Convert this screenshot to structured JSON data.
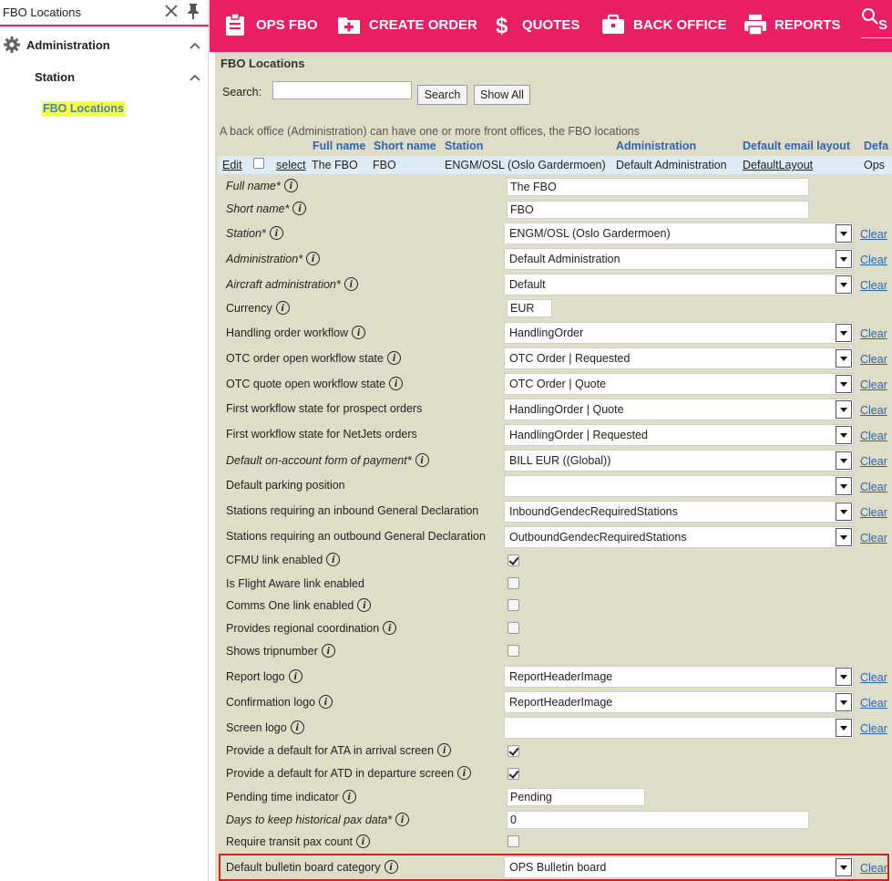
{
  "sidebar": {
    "search_value": "FBO Locations",
    "administration_label": "Administration",
    "station_label": "Station",
    "fbo_locations_label": "FBO Locations"
  },
  "nav": {
    "ops_fbo": "OPS FBO",
    "create_order": "CREATE ORDER",
    "quotes": "QUOTES",
    "back_office": "BACK OFFICE",
    "reports": "REPORTS",
    "search_partial": "S"
  },
  "colors": {
    "accent": "#e91e63",
    "panel_bg": "#deddc8",
    "link": "#2b64b4",
    "highlight": "#ffff33"
  },
  "panel": {
    "title": "FBO Locations",
    "search_label": "Search:",
    "search_value": "",
    "search_button": "Search",
    "show_all_button": "Show All",
    "description": "A back office (Administration) can have one or more front offices, the FBO locations"
  },
  "columns": [
    "Full name",
    "Short name",
    "Station",
    "Administration",
    "Default email layout",
    "Defa"
  ],
  "list_row": {
    "edit": "Edit",
    "select": "select",
    "full_name": "The FBO",
    "short_name": "FBO",
    "station": "ENGM/OSL (Oslo Gardermoen)",
    "administration": "Default Administration",
    "email_layout": "DefaultLayout",
    "default": "Ops"
  },
  "clear_label": "Clear",
  "fields": {
    "full_name": {
      "label": "Full name*",
      "value": "The FBO"
    },
    "short_name": {
      "label": "Short name*",
      "value": "FBO"
    },
    "station": {
      "label": "Station*",
      "value": "ENGM/OSL (Oslo Gardermoen)"
    },
    "administration": {
      "label": "Administration*",
      "value": "Default Administration"
    },
    "aircraft_administration": {
      "label": "Aircraft administration*",
      "value": "Default"
    },
    "currency": {
      "label": "Currency",
      "value": "EUR"
    },
    "handling_order_workflow": {
      "label": "Handling order workflow",
      "value": "HandlingOrder"
    },
    "otc_order_open": {
      "label": "OTC order open workflow state",
      "value": "OTC Order | Requested"
    },
    "otc_quote_open": {
      "label": "OTC quote open workflow state",
      "value": "OTC Order | Quote"
    },
    "first_state_prospect": {
      "label": "First workflow state for prospect orders",
      "value": "HandlingOrder | Quote"
    },
    "first_state_netjets": {
      "label": "First workflow state for NetJets orders",
      "value": "HandlingOrder | Requested"
    },
    "default_payment": {
      "label": "Default on-account form of payment*",
      "value": "BILL EUR ((Global))"
    },
    "parking_position": {
      "label": "Default parking position",
      "value": ""
    },
    "inbound_gendec": {
      "label": "Stations requiring an inbound General Declaration",
      "value": "InboundGendecRequiredStations"
    },
    "outbound_gendec": {
      "label": "Stations requiring an outbound General Declaration",
      "value": "OutboundGendecRequiredStations"
    },
    "cfmu_link": {
      "label": "CFMU link enabled",
      "checked": true
    },
    "flight_aware": {
      "label": "Is Flight Aware link enabled",
      "checked": false
    },
    "comms_one": {
      "label": "Comms One link enabled",
      "checked": false
    },
    "regional_coordination": {
      "label": "Provides regional coordination",
      "checked": false
    },
    "shows_tripnumber": {
      "label": "Shows tripnumber",
      "checked": false
    },
    "report_logo": {
      "label": "Report logo",
      "value": "ReportHeaderImage"
    },
    "confirmation_logo": {
      "label": "Confirmation logo",
      "value": "ReportHeaderImage"
    },
    "screen_logo": {
      "label": "Screen logo",
      "value": ""
    },
    "default_ata": {
      "label": "Provide a default for ATA in arrival screen",
      "checked": true
    },
    "default_atd": {
      "label": "Provide a default for ATD in departure screen",
      "checked": true
    },
    "pending_time": {
      "label": "Pending time indicator",
      "value": "Pending"
    },
    "days_historical": {
      "label": "Days to keep historical pax data*",
      "value": "0"
    },
    "transit_pax": {
      "label": "Require transit pax count",
      "checked": false
    },
    "bulletin_category": {
      "label": "Default bulletin board category",
      "value": "OPS Bulletin board"
    }
  }
}
